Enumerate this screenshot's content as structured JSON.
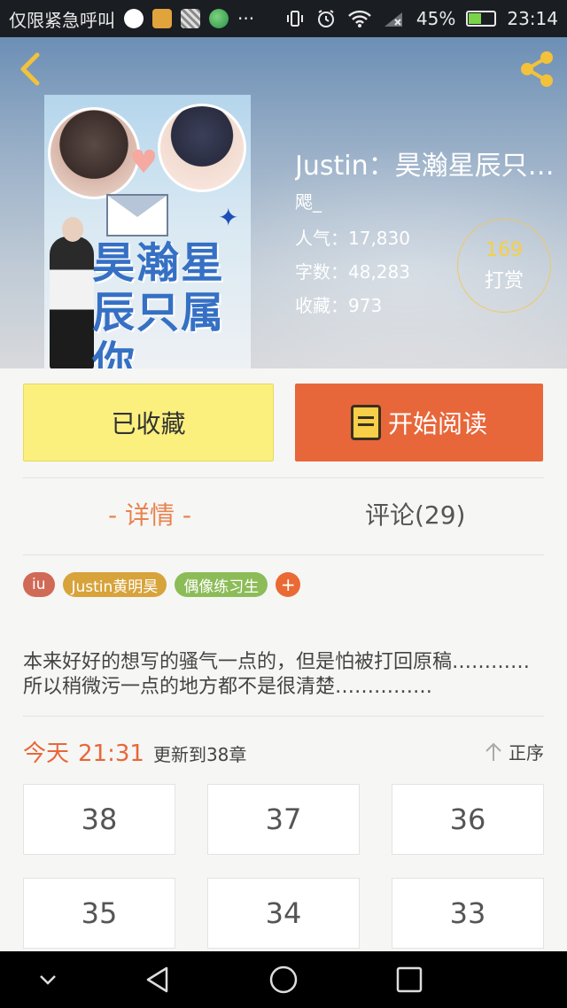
{
  "status_bar": {
    "notice": "仅限紧急呼叫",
    "more": "···",
    "battery": "45%",
    "battery_level": 0.45,
    "time": "23:14"
  },
  "book": {
    "title": "Justin：昊瀚星辰只…",
    "cover_title": "昊瀚星辰只属你",
    "author": "飔_",
    "stats": [
      {
        "label": "人气：",
        "value": "17,830"
      },
      {
        "label": "字数：",
        "value": "48,283"
      },
      {
        "label": "收藏：",
        "value": "973"
      }
    ],
    "reward": {
      "count": "169",
      "label": "打赏"
    }
  },
  "actions": {
    "collect_label": "已收藏",
    "read_label": "开始阅读"
  },
  "tabs": {
    "detail": "- 详情 -",
    "comments": "评论(29)"
  },
  "tags": [
    "iu",
    "Justin黄明昊",
    "偶像练习生",
    "+"
  ],
  "description": "本来好好的想写的骚气一点的，但是怕被打回原稿…………所以稍微污一点的地方都不是很清楚……………",
  "update": {
    "day": "今天",
    "time": "21:31",
    "text": "更新到38章",
    "order_label": "正序"
  },
  "chapters": [
    "38",
    "37",
    "36",
    "35",
    "34",
    "33"
  ],
  "colors": {
    "accent": "#e8673a",
    "collect_bg": "#fbf07e",
    "reward_count": "#f5cf45"
  }
}
